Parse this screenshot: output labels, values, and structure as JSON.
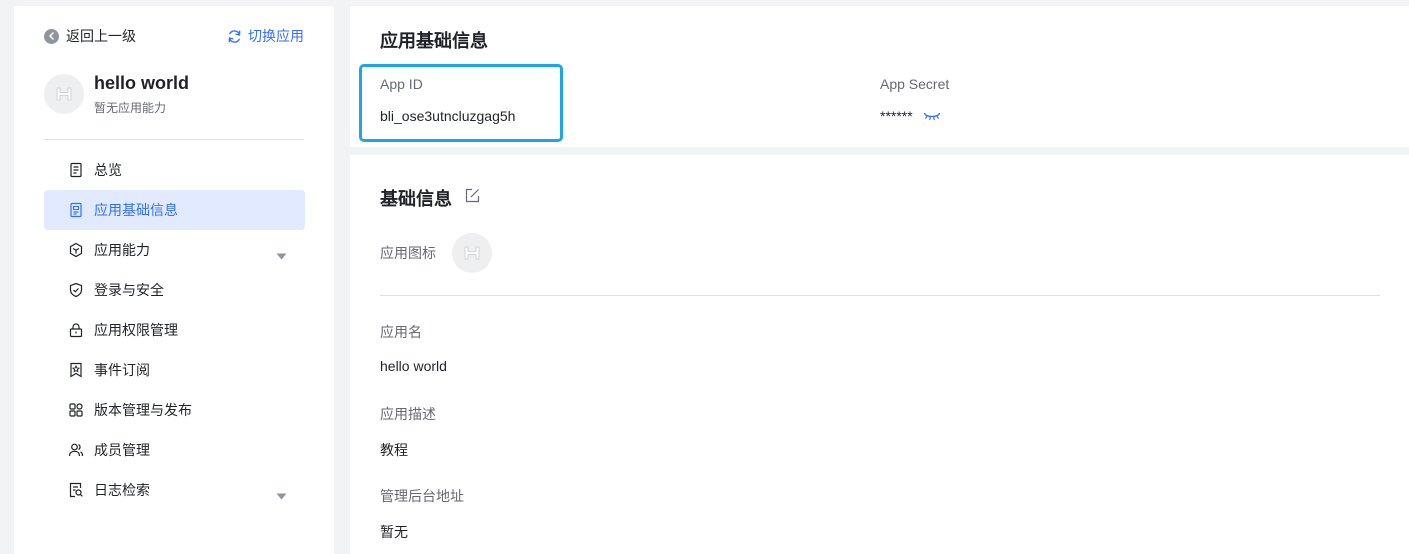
{
  "sidebar": {
    "back_label": "返回上一级",
    "switch_label": "切换应用",
    "app_name": "hello world",
    "app_subtitle": "暂无应用能力",
    "items": [
      {
        "label": "总览",
        "icon": "document-list-icon"
      },
      {
        "label": "应用基础信息",
        "icon": "document-icon",
        "active": true
      },
      {
        "label": "应用能力",
        "icon": "hexagon-icon",
        "expandable": true
      },
      {
        "label": "登录与安全",
        "icon": "shield-icon"
      },
      {
        "label": "应用权限管理",
        "icon": "lock-icon"
      },
      {
        "label": "事件订阅",
        "icon": "bookmark-icon"
      },
      {
        "label": "版本管理与发布",
        "icon": "grid-icon"
      },
      {
        "label": "成员管理",
        "icon": "users-icon"
      },
      {
        "label": "日志检索",
        "icon": "log-search-icon",
        "expandable": true
      }
    ]
  },
  "credentials": {
    "title": "应用基础信息",
    "app_id_label": "App ID",
    "app_id_value": "bli_ose3utncluzgag5h",
    "app_secret_label": "App Secret",
    "app_secret_value": "******"
  },
  "basic_info": {
    "title": "基础信息",
    "icon_label": "应用图标",
    "name_label": "应用名",
    "name_value": "hello world",
    "desc_label": "应用描述",
    "desc_value": "教程",
    "admin_url_label": "管理后台地址",
    "admin_url_value": "暂无"
  },
  "colors": {
    "accent": "#3370ff",
    "active_bg": "#e1eaff",
    "highlight": "#1ba6e8"
  }
}
